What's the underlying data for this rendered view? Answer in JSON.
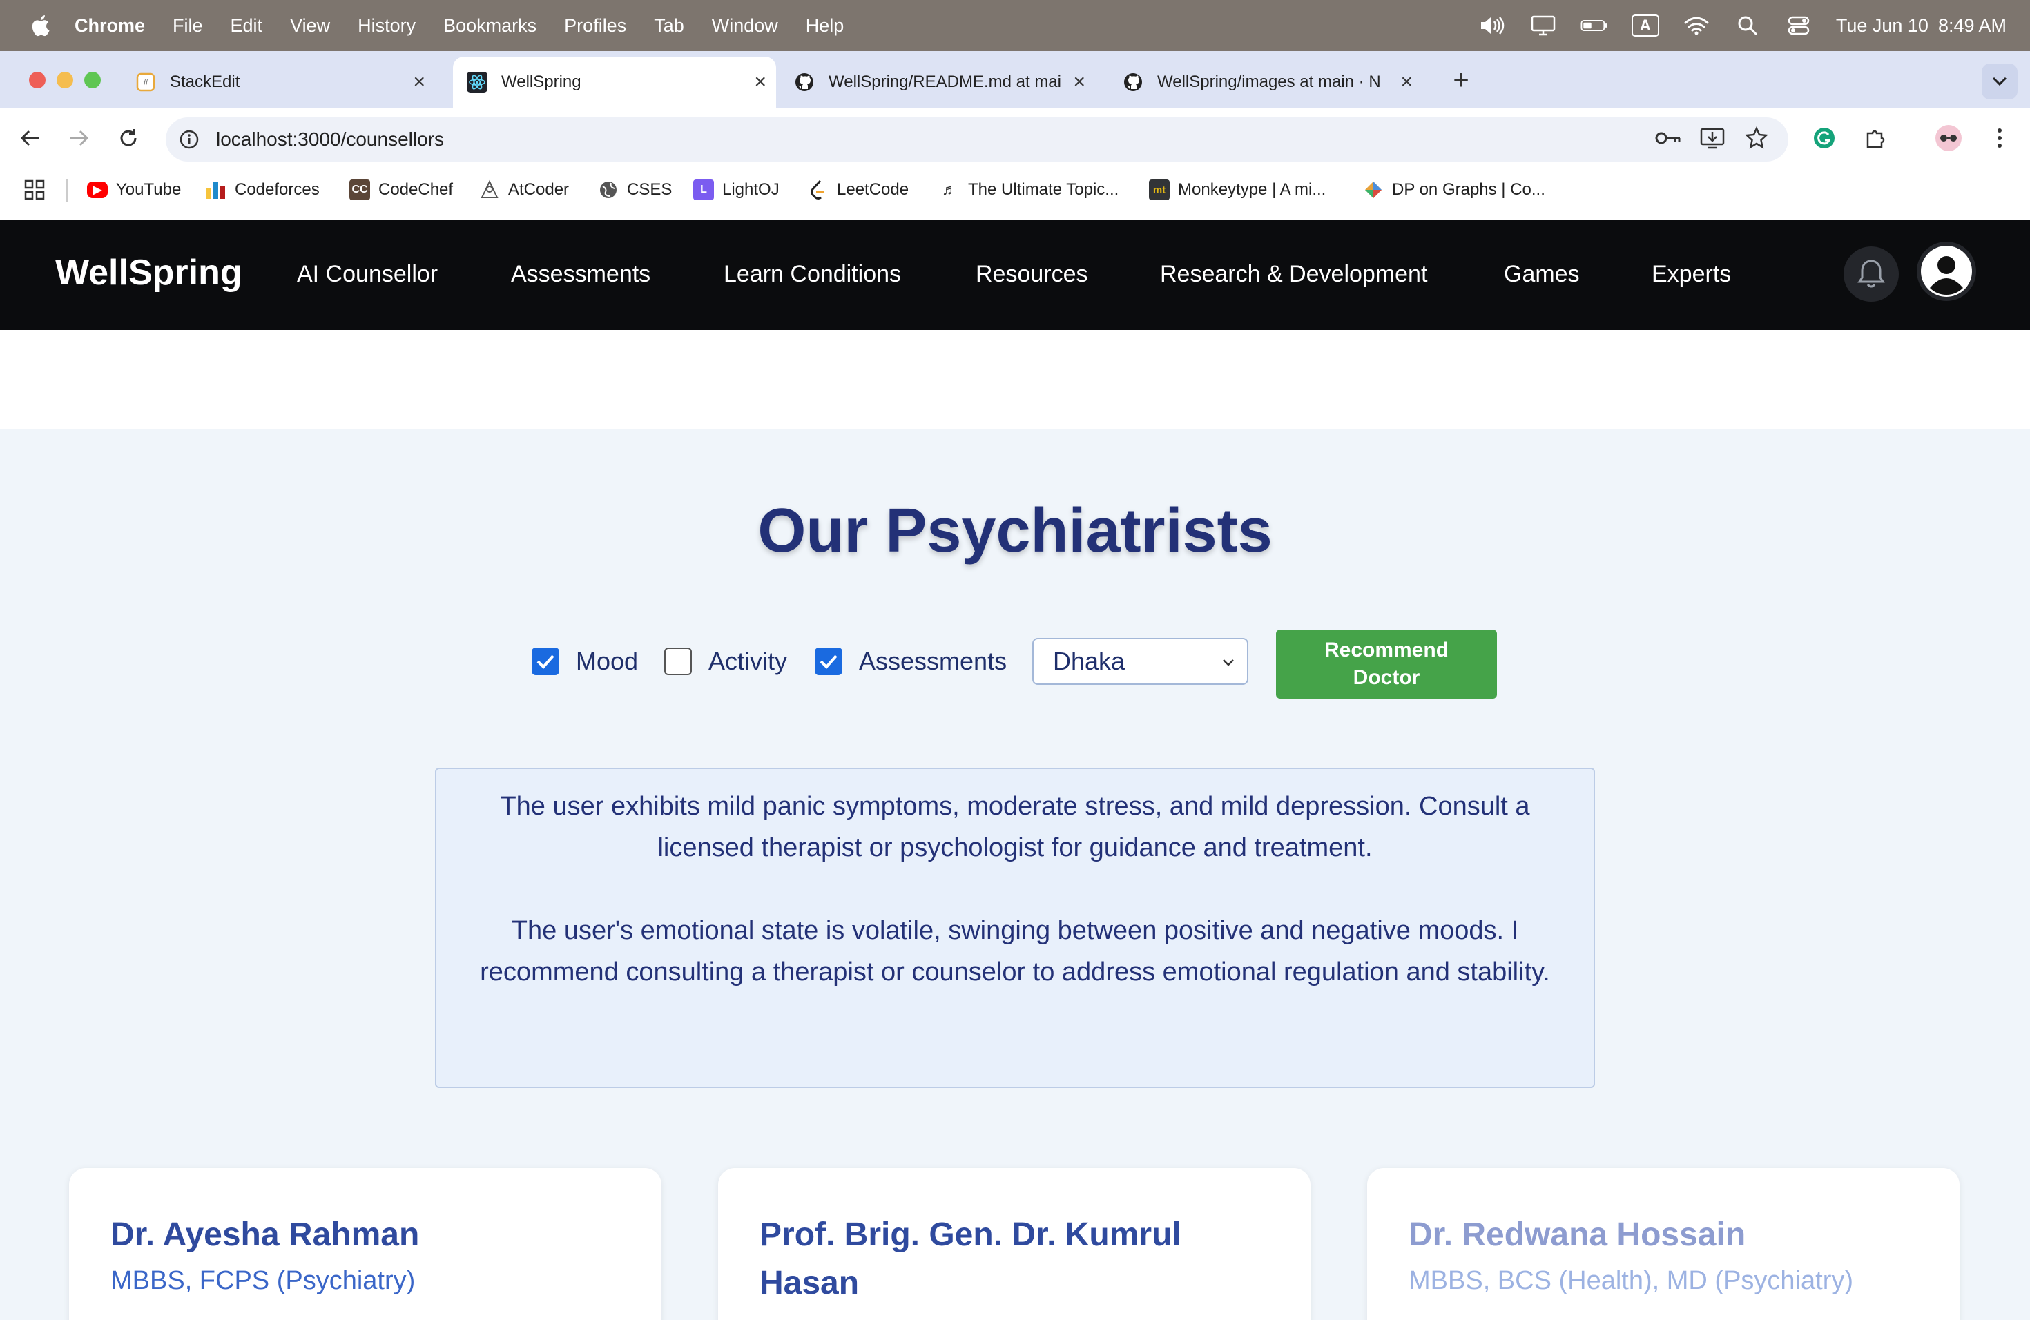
{
  "menubar": {
    "app": "Chrome",
    "items": [
      "File",
      "Edit",
      "View",
      "History",
      "Bookmarks",
      "Profiles",
      "Tab",
      "Window",
      "Help"
    ],
    "date": "Tue Jun 10",
    "time": "8:49 AM",
    "input_indicator": "A"
  },
  "tabs": [
    {
      "title": "StackEdit",
      "icon": "stackedit-icon"
    },
    {
      "title": "WellSpring",
      "icon": "react-icon"
    },
    {
      "title": "WellSpring/README.md at main",
      "icon": "github-icon"
    },
    {
      "title": "WellSpring/images at main · N",
      "icon": "github-icon"
    }
  ],
  "address": {
    "url": "localhost:3000/counsellors"
  },
  "bookmarks": [
    "YouTube",
    "Codeforces",
    "CodeChef",
    "AtCoder",
    "CSES",
    "LightOJ",
    "LeetCode",
    "The Ultimate Topic...",
    "Monkeytype | A mi...",
    "DP on Graphs | Co..."
  ],
  "app_nav": {
    "brand": "WellSpring",
    "links": [
      "AI Counsellor",
      "Assessments",
      "Learn Conditions",
      "Resources",
      "Research & Development",
      "Games",
      "Experts"
    ]
  },
  "page": {
    "title": "Our Psychiatrists",
    "filters": [
      {
        "label": "Mood",
        "checked": true
      },
      {
        "label": "Activity",
        "checked": false
      },
      {
        "label": "Assessments",
        "checked": true
      }
    ],
    "location_select": {
      "value": "Dhaka"
    },
    "recommend_button_line1": "Recommend",
    "recommend_button_line2": "Doctor",
    "summary": [
      "The user exhibits mild panic symptoms, moderate stress, and mild depression. Consult a licensed therapist or psychologist for guidance and treatment.",
      "The user's emotional state is volatile, swinging between positive and negative moods. I recommend consulting a therapist or counselor to address emotional regulation and stability."
    ],
    "doctors": [
      {
        "name": "Dr. Ayesha Rahman",
        "qualification": "MBBS, FCPS (Psychiatry)"
      },
      {
        "name": "Prof. Brig. Gen. Dr. Kumrul Hasan",
        "qualification": ""
      },
      {
        "name": "Dr. Redwana Hossain",
        "qualification": "MBBS, BCS (Health), MD (Psychiatry)"
      }
    ]
  },
  "colors": {
    "nav_bg": "#0b0c0e",
    "title": "#233177",
    "button_green": "#45a349",
    "checkbox_blue": "#1a6ae0",
    "summary_bg": "#e8f0fb"
  }
}
